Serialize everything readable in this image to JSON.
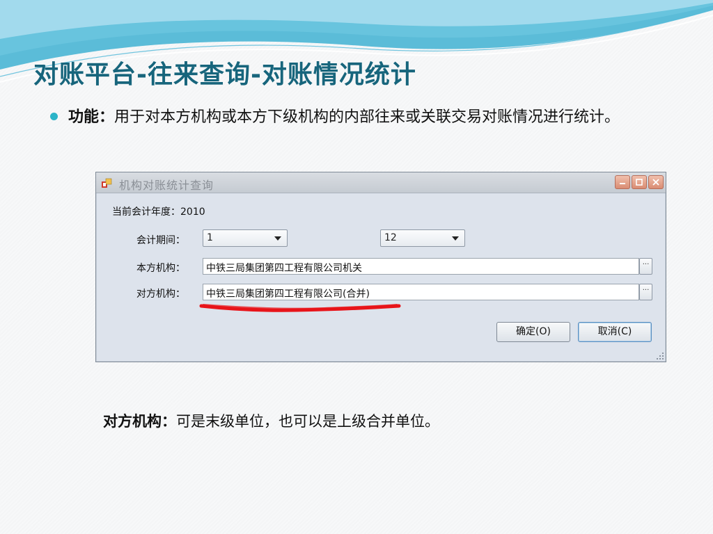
{
  "slide": {
    "title": "对账平台-往来查询-对账情况统计",
    "bullet": {
      "label": "功能：",
      "text": "用于对本方机构或本方下级机构的内部往来或关联交易对账情况进行统计。"
    },
    "note": {
      "label": "对方机构：",
      "text": "可是末级单位，也可以是上级合并单位。"
    }
  },
  "window": {
    "title": "机构对账统计查询",
    "fiscal_year_label": "当前会计年度：",
    "fiscal_year": "2010",
    "period_label": "会计期间：",
    "period_from": "1",
    "period_to": "12",
    "own_org_label": "本方机构：",
    "own_org_value": "中铁三局集团第四工程有限公司机关",
    "counter_org_label": "对方机构：",
    "counter_org_value": "中铁三局集团第四工程有限公司(合并)",
    "ellipsis": "···",
    "ok_button": "确定(O)",
    "cancel_button": "取消(C)"
  },
  "colors": {
    "title": "#17657c",
    "bullet": "#2bb4c8",
    "annotation": "#e8141a"
  },
  "icons": [
    "app-icon",
    "minimize-icon",
    "maximize-icon",
    "close-icon",
    "chevron-down-icon",
    "resize-grip-icon"
  ]
}
